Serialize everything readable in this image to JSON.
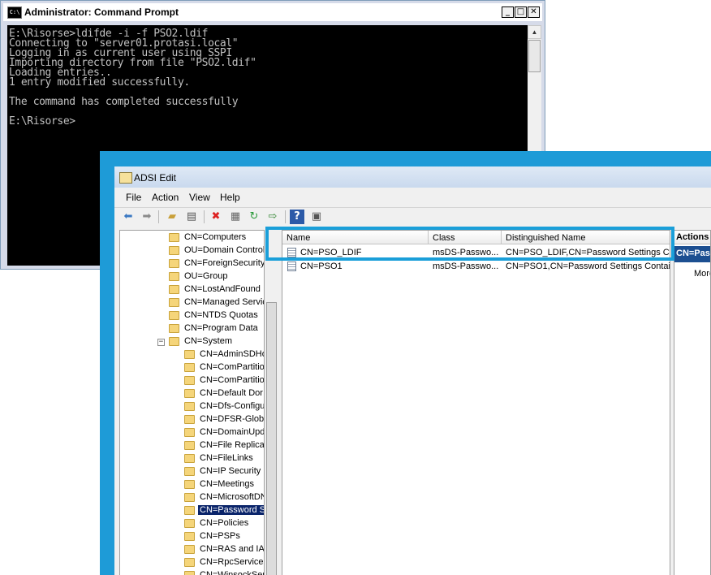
{
  "cmd": {
    "title": "Administrator: Command Prompt",
    "icon": "console-icon",
    "lines": [
      "E:\\Risorse>ldifde -i -f PSO2.ldif",
      "Connecting to \"server01.protasi.local\"",
      "Logging in as current user using SSPI",
      "Importing directory from file \"PSO2.ldif\"",
      "Loading entries..",
      "1 entry modified successfully.",
      "",
      "The command has completed successfully",
      "",
      "E:\\Risorse>"
    ]
  },
  "adsi": {
    "title": "ADSI Edit",
    "menu": [
      "File",
      "Action",
      "View",
      "Help"
    ],
    "toolbar": [
      "back-arrow-icon",
      "forward-arrow-icon",
      "up-folder-icon",
      "show-hide-tree-icon",
      "delete-icon",
      "properties-icon",
      "refresh-icon",
      "export-list-icon",
      "help-icon",
      "show-hide-action-pane-icon"
    ],
    "tree": [
      {
        "label": "CN=Computers",
        "level": 1
      },
      {
        "label": "OU=Domain Controll",
        "level": 1
      },
      {
        "label": "CN=ForeignSecurity",
        "level": 1
      },
      {
        "label": "OU=Group",
        "level": 1
      },
      {
        "label": "CN=LostAndFound",
        "level": 1
      },
      {
        "label": "CN=Managed Servic",
        "level": 1
      },
      {
        "label": "CN=NTDS Quotas",
        "level": 1
      },
      {
        "label": "CN=Program Data",
        "level": 1
      },
      {
        "label": "CN=System",
        "level": 1,
        "expanded": true
      },
      {
        "label": "CN=AdminSDHo",
        "level": 2
      },
      {
        "label": "CN=ComPartitio",
        "level": 2
      },
      {
        "label": "CN=ComPartitio",
        "level": 2
      },
      {
        "label": "CN=Default Dor",
        "level": 2
      },
      {
        "label": "CN=Dfs-Configu",
        "level": 2
      },
      {
        "label": "CN=DFSR-Globa",
        "level": 2
      },
      {
        "label": "CN=DomainUpd",
        "level": 2
      },
      {
        "label": "CN=File Replicat",
        "level": 2
      },
      {
        "label": "CN=FileLinks",
        "level": 2
      },
      {
        "label": "CN=IP Security",
        "level": 2
      },
      {
        "label": "CN=Meetings",
        "level": 2
      },
      {
        "label": "CN=MicrosoftDN",
        "level": 2
      },
      {
        "label": "CN=Password S",
        "level": 2,
        "selected": true
      },
      {
        "label": "CN=Policies",
        "level": 2
      },
      {
        "label": "CN=PSPs",
        "level": 2
      },
      {
        "label": "CN=RAS and IA",
        "level": 2
      },
      {
        "label": "CN=RpcServices",
        "level": 2
      },
      {
        "label": "CN=WinsockSer",
        "level": 2
      }
    ],
    "columns": [
      "Name",
      "Class",
      "Distinguished Name"
    ],
    "rows": [
      {
        "name": "CN=PSO_LDIF",
        "class": "msDS-Passwo...",
        "dn": "CN=PSO_LDIF,CN=Password Settings Co"
      },
      {
        "name": "CN=PSO1",
        "class": "msDS-Passwo...",
        "dn": "CN=PSO1,CN=Password Settings Contai"
      }
    ],
    "actions": {
      "header": "Actions",
      "section": "CN=Pas",
      "more": "More"
    }
  }
}
